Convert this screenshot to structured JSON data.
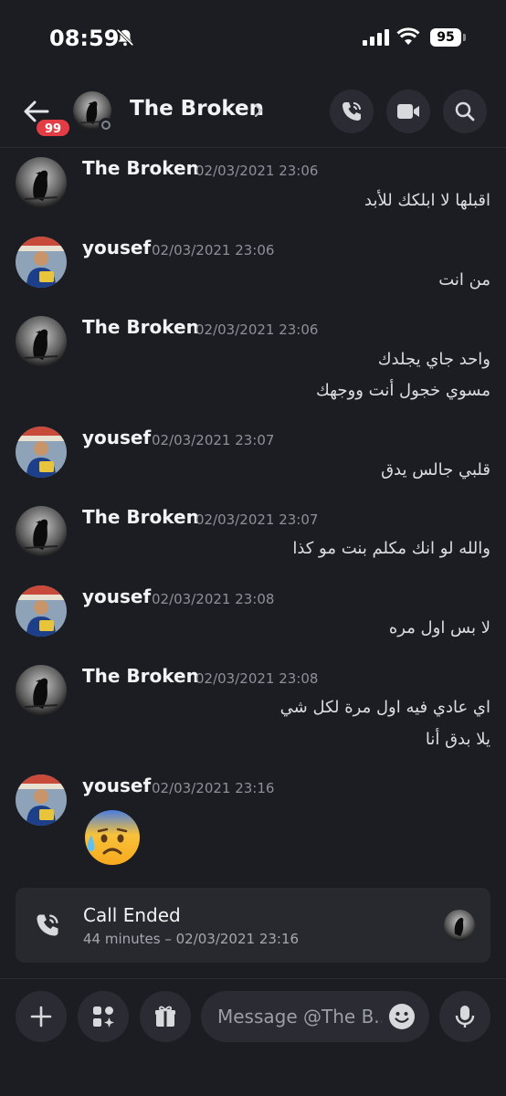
{
  "status_bar": {
    "time": "08:59",
    "battery": "95"
  },
  "header": {
    "back_badge": "99",
    "title": "The Broken",
    "icons": [
      "back-arrow-icon",
      "phone-icon",
      "video-icon",
      "search-icon"
    ]
  },
  "messages": [
    {
      "author": "The Broken",
      "time": "02/03/2021 23:06",
      "lines": [
        "اقبلها لا ابلكك للأبد"
      ]
    },
    {
      "author": "yousef",
      "time": "02/03/2021 23:06",
      "lines": [
        "من انت"
      ]
    },
    {
      "author": "The Broken",
      "time": "02/03/2021 23:06",
      "lines": [
        "واحد جاي يجلدك",
        "مسوي خجول أنت ووجهك"
      ]
    },
    {
      "author": "yousef",
      "time": "02/03/2021 23:07",
      "lines": [
        "قلبي جالس يدق"
      ]
    },
    {
      "author": "The Broken",
      "time": "02/03/2021 23:07",
      "lines": [
        "والله لو انك مكلم بنت مو كذا"
      ]
    },
    {
      "author": "yousef",
      "time": "02/03/2021 23:08",
      "lines": [
        "لا بس اول مره"
      ]
    },
    {
      "author": "The Broken",
      "time": "02/03/2021 23:08",
      "lines": [
        "اي عادي فيه اول مرة لكل شي",
        "يلا بدق أنا"
      ]
    },
    {
      "author": "yousef",
      "time": "02/03/2021 23:16",
      "emoji": "anxious-sweat-face-emoji"
    }
  ],
  "call": {
    "title": "Call Ended",
    "subtitle": "44 minutes – 02/03/2021 23:16"
  },
  "composer": {
    "placeholder": "Message @The B..."
  },
  "colors": {
    "background": "#1c1d23",
    "badge": "#e43c44",
    "card": "#28292f"
  }
}
